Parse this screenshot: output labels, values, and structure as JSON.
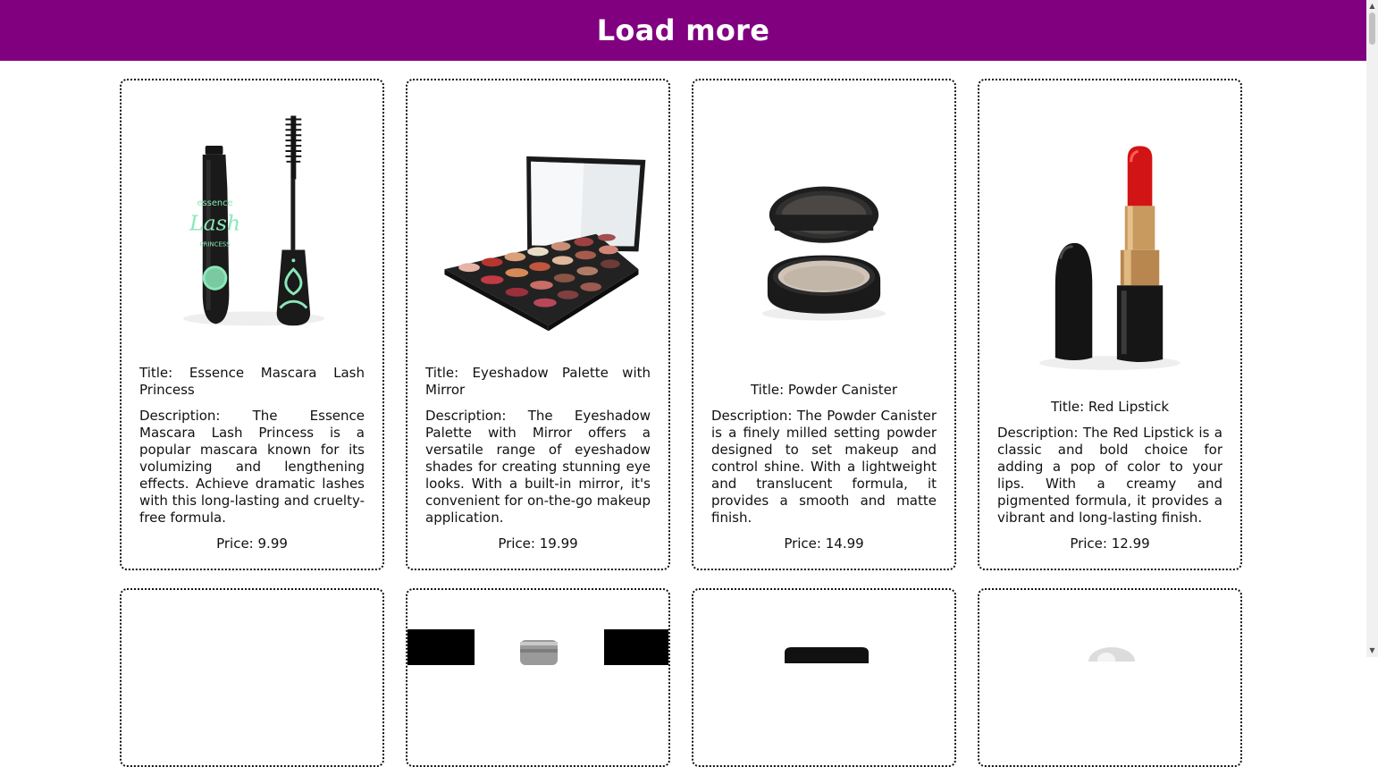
{
  "header": {
    "load_more_label": "Load more"
  },
  "products": [
    {
      "title": "Title: Essence Mascara Lash Princess",
      "description": "Description: The Essence Mascara Lash Princess is a popular mascara known for its volumizing and lengthening effects. Achieve dramatic lashes with this long-lasting and cruelty-free formula.",
      "price": "Price: 9.99",
      "image_icon": "mascara-icon",
      "image_text": {
        "brand": "essence",
        "name": "Lash",
        "sub": "PRINCESS"
      }
    },
    {
      "title": "Title: Eyeshadow Palette with Mirror",
      "description": "Description: The Eyeshadow Palette with Mirror offers a versatile range of eyeshadow shades for creating stunning eye looks. With a built-in mirror, it's convenient for on-the-go makeup application.",
      "price": "Price: 19.99",
      "image_icon": "eyeshadow-palette-icon"
    },
    {
      "title": "Title: Powder Canister",
      "description": "Description: The Powder Canister is a finely milled setting powder designed to set makeup and control shine. With a lightweight and translucent formula, it provides a smooth and matte finish.",
      "price": "Price: 14.99",
      "image_icon": "powder-canister-icon"
    },
    {
      "title": "Title: Red Lipstick",
      "description": "Description: The Red Lipstick is a classic and bold choice for adding a pop of color to your lips. With a creamy and pigmented formula, it provides a vibrant and long-lasting finish.",
      "price": "Price: 12.99",
      "image_icon": "red-lipstick-icon"
    }
  ],
  "colors": {
    "header_bg": "#800080",
    "header_text": "#ffffff",
    "lipstick": "#d31414"
  }
}
